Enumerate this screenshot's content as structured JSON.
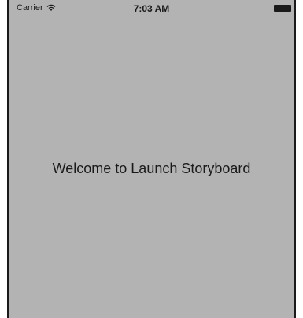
{
  "status_bar": {
    "carrier": "Carrier",
    "wifi_icon": "wifi-icon",
    "time": "7:03 AM",
    "battery_icon": "battery-icon"
  },
  "main": {
    "welcome_text": "Welcome to Launch Storyboard"
  },
  "colors": {
    "background": "#b3b3b3",
    "text": "#1a1a1a"
  }
}
